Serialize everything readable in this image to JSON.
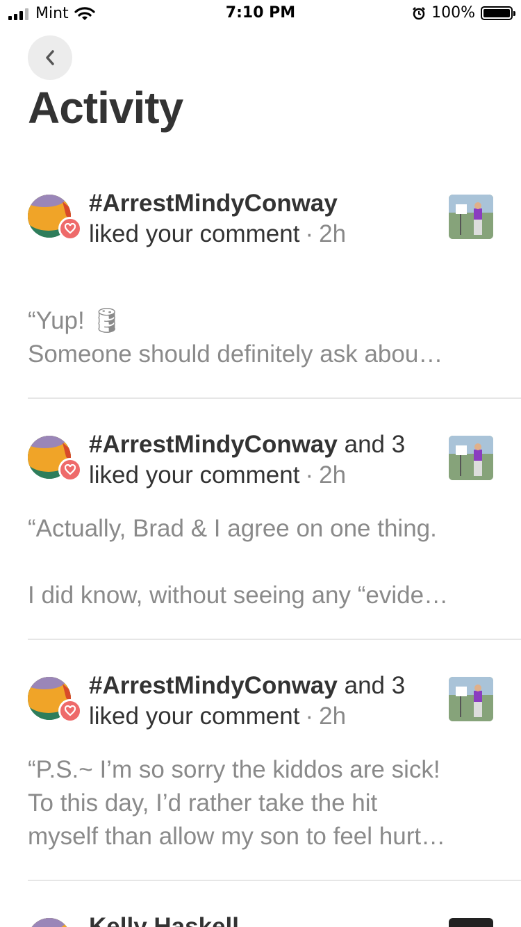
{
  "status_bar": {
    "carrier": "Mint",
    "time": "7:10 PM",
    "battery": "100%"
  },
  "header": {
    "title": "Activity",
    "back_icon": "chevron-left-icon"
  },
  "items": [
    {
      "actor": "#ArrestMindyConway",
      "others": "",
      "action": "liked your comment",
      "separator": "·",
      "time": "2h",
      "quote_line1": "“Yup! ",
      "emoji": "🛢",
      "quote_rest": "Someone should definitely ask abou…"
    },
    {
      "actor": "#ArrestMindyConway",
      "others": " and 3",
      "action": "liked your comment",
      "separator": "·",
      "time": "2h",
      "quote": "“Actually, Brad & I agree on one thing.\n\nI did know, without seeing any “evide…"
    },
    {
      "actor": "#ArrestMindyConway",
      "others": " and 3",
      "action": "liked your comment",
      "separator": "·",
      "time": "2h",
      "quote": "“P.S.~ I’m so sorry the kiddos are sick!\nTo this day, I’d rather take the hit\nmyself than allow my son to feel hurt…"
    },
    {
      "actor": "Kelly Haskell"
    }
  ],
  "colors": {
    "heart_badge": "#ee6a6a",
    "title": "#333333",
    "quote": "#8a8a8a",
    "back_button_bg": "#ececec"
  }
}
